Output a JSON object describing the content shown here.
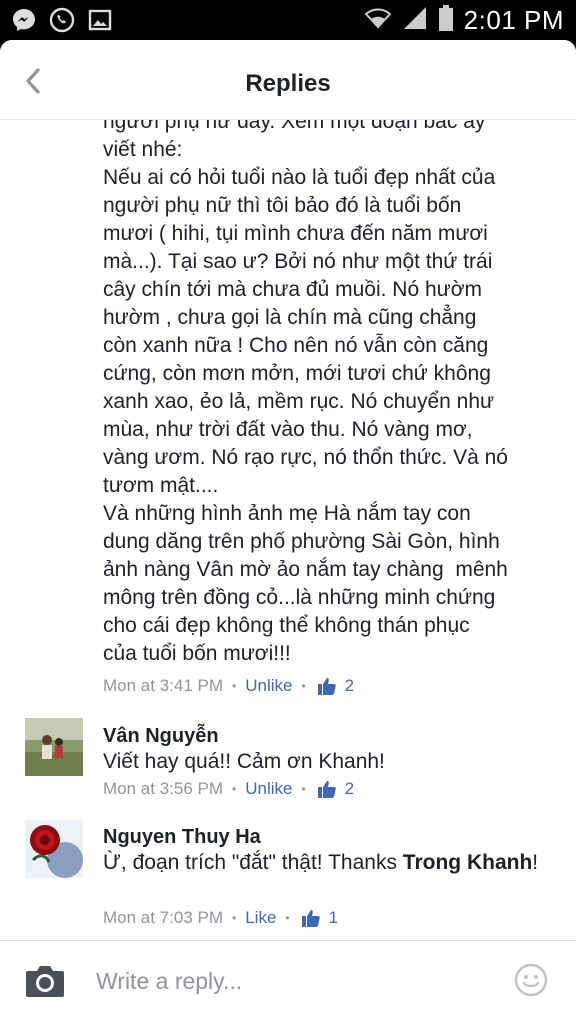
{
  "statusbar": {
    "time": "2:01 PM",
    "icons": [
      "messenger-icon",
      "phone-icon",
      "gallery-icon",
      "wifi-icon",
      "signal-icon",
      "battery-icon"
    ]
  },
  "header": {
    "title": "Replies"
  },
  "thread": {
    "text": "người phụ nữ đây. Xem một đoạn bác ấy\nviết nhé:\nNếu ai có hỏi tuổi nào là tuổi đẹp nhất của\nngười phụ nữ thì tôi bảo đó là tuổi bốn\nmươi ( hihi, tụi mình chưa đến năm mươi\nmà...). Tại sao ư? Bởi nó như một thứ trái\ncây chín tới mà chưa đủ muồi. Nó hườm\nhườm , chưa gọi là chín mà cũng chẳng\ncòn xanh nữa ! Cho nên nó vẫn còn căng\ncứng, còn mơn mởn, mới tươi chứ không\nxanh xao, ẻo lả, mềm rục. Nó chuyển như\nmùa, như trời đất vào thu. Nó vàng mơ,\nvàng ươm. Nó rạo rực, nó thổn thức. Và nó\ntươm mật....\nVà những hình ảnh mẹ Hà nắm tay con\ndung dăng trên phố phường Sài Gòn, hình\nảnh nàng Vân mờ ảo nắm tay chàng  mênh\nmông trên đồng cỏ...là những minh chứng\ncho cái đẹp không thể không thán phục\ncủa tuổi bốn mươi!!!",
    "time": "Mon at 3:41 PM",
    "action": "Unlike",
    "likes": "2"
  },
  "replies": [
    {
      "name": "Vân Nguyễn",
      "text": "Viết hay quá!! Cảm ơn Khanh!",
      "time": "Mon at 3:56 PM",
      "action": "Unlike",
      "likes": "2"
    },
    {
      "name": "Nguyen Thuy Ha",
      "text_before": "Ừ, đoạn trích \"đắt\" thật! Thanks ",
      "tag": "Trong Khanh",
      "text_after": "!",
      "time": "Mon at 7:03 PM",
      "action": "Like",
      "likes": "1"
    }
  ],
  "composer": {
    "placeholder": "Write a reply..."
  },
  "colors": {
    "link": "#4267b2",
    "meta": "#90949c",
    "text": "#1d2129"
  }
}
